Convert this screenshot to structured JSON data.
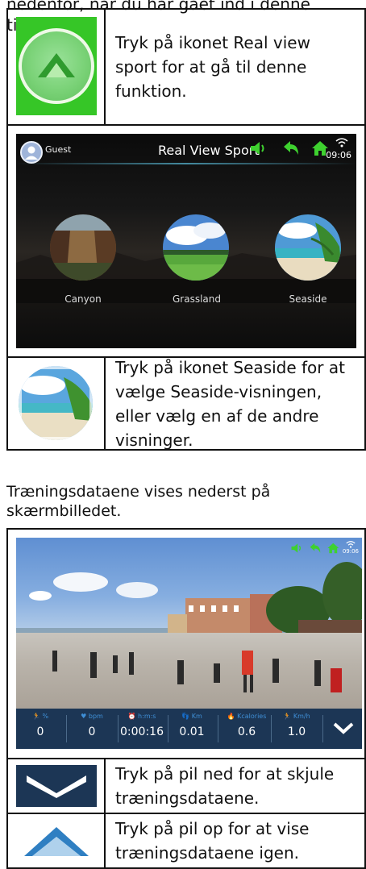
{
  "intro": {
    "text": "nedenfor, når du har gået ind i denne tilstand."
  },
  "row1": {
    "icon": "real-view-sport-icon",
    "text": "Tryk på ikonet Real view sport for at gå til denne funktion."
  },
  "screenshot1": {
    "user": "Guest",
    "title": "Real View Sport",
    "time": "09:06",
    "icons": [
      "volume-icon",
      "back-icon",
      "home-icon",
      "wifi-icon"
    ],
    "scenes": [
      "Canyon",
      "Grassland",
      "Seaside"
    ]
  },
  "row3": {
    "icon": "seaside-icon",
    "text": "Tryk på ikonet Seaside for at vælge Seaside-visningen, eller vælg en af de andre visninger."
  },
  "caption": "Træningsdataene vises nederst på skærmbilledet.",
  "screenshot2": {
    "time": "09:06",
    "stats": [
      {
        "label": "%",
        "value": "0"
      },
      {
        "label": "bpm",
        "value": "0"
      },
      {
        "label": "h:m:s",
        "value": "0:00:16"
      },
      {
        "label": "Km",
        "value": "0.01"
      },
      {
        "label": "Kcalories",
        "value": "0.6"
      },
      {
        "label": "Km/h",
        "value": "1.0"
      }
    ]
  },
  "row_down": {
    "icon": "chevron-down-icon",
    "text": "Tryk på pil ned for at skjule træningsdataene."
  },
  "row_up": {
    "icon": "chevron-up-icon",
    "text": "Tryk på pil op for at vise træningsdataene igen."
  },
  "colors": {
    "green": "#36c627",
    "stats_bar": "#1c3655",
    "stat_label": "#3f8fd6"
  }
}
